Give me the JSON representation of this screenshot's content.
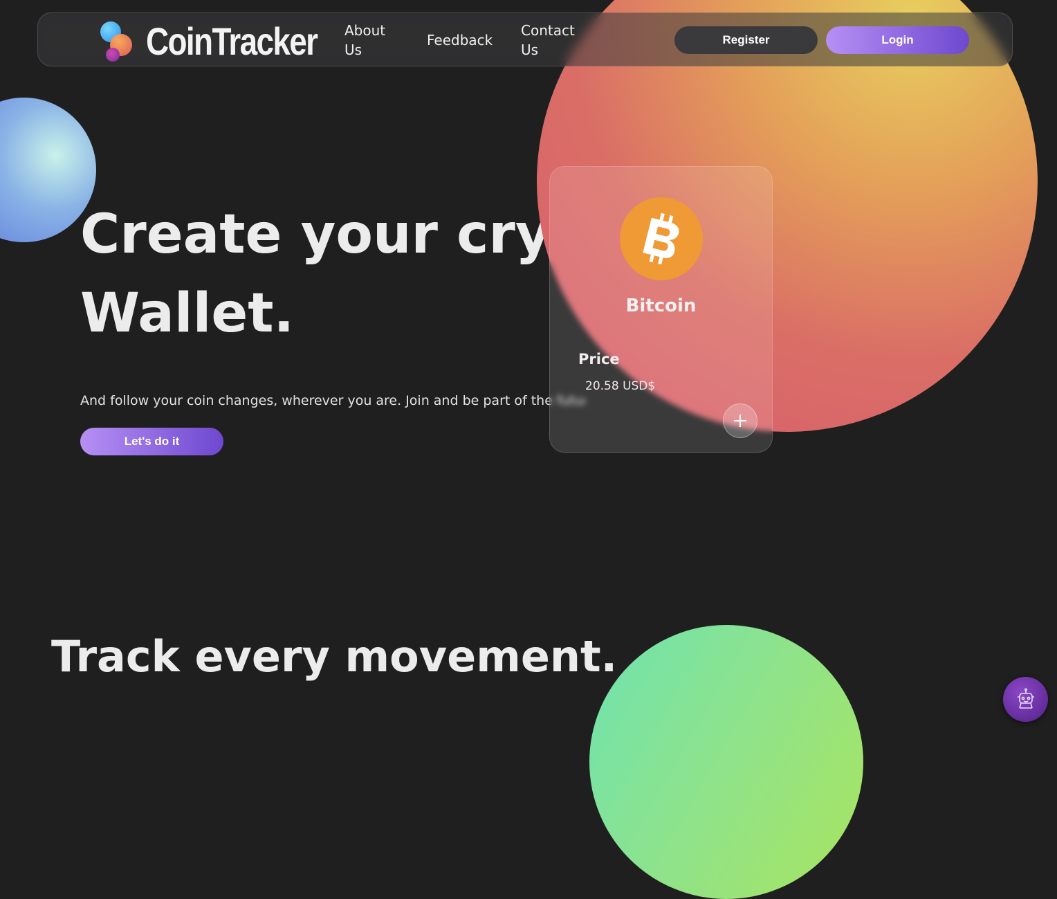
{
  "brand": {
    "name": "CoinTracker"
  },
  "nav": {
    "about": "About Us",
    "feedback": "Feedback",
    "contact": "Contact Us",
    "register": "Register",
    "login": "Login"
  },
  "hero": {
    "title_line1": "Create your crypto",
    "title_line2": "Wallet.",
    "subtitle": "And follow your coin changes, wherever you are. Join and be part of the future.",
    "cta": "Let's do it"
  },
  "coin_card": {
    "name": "Bitcoin",
    "price_label": "Price",
    "price_value": "20.58 USD$",
    "icon": "bitcoin-icon",
    "add_icon": "plus-icon"
  },
  "section2": {
    "title": "Track every movement."
  },
  "assistant": {
    "icon": "robot-icon"
  },
  "colors": {
    "background": "#1f1f20",
    "accent_start": "#b690f4",
    "accent_end": "#6e48cf",
    "bitcoin": "#ef9a35"
  }
}
